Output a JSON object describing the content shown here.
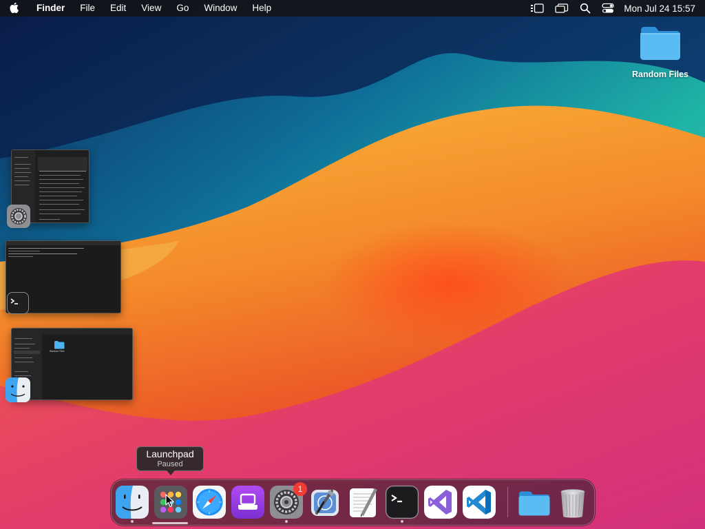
{
  "menubar": {
    "icon": "apple-icon",
    "app_name": "Finder",
    "menus": [
      "File",
      "Edit",
      "View",
      "Go",
      "Window",
      "Help"
    ],
    "status_icons": [
      "stage-manager-icon",
      "screen-mirroring-icon",
      "search-icon",
      "control-center-icon"
    ],
    "clock": "Mon Jul 24  15:57"
  },
  "desktop": {
    "folder": {
      "label": "Random Files",
      "icon": "folder-icon"
    }
  },
  "stage_manager": {
    "windows": [
      {
        "app": "System Settings",
        "icon": "system-settings-icon"
      },
      {
        "app": "Terminal",
        "icon": "terminal-icon"
      },
      {
        "app": "Finder",
        "icon": "finder-icon",
        "item_label": "Random Files"
      }
    ]
  },
  "tooltip": {
    "title": "Launchpad",
    "subtitle": "Paused"
  },
  "dock": {
    "apps": [
      {
        "name": "Finder",
        "icon": "finder-icon",
        "running": true
      },
      {
        "name": "Launchpad",
        "icon": "launchpad-icon",
        "running": false
      },
      {
        "name": "Safari",
        "icon": "safari-icon",
        "running": false
      },
      {
        "name": "Podcast-like App",
        "icon": "purple-app-icon",
        "running": false
      },
      {
        "name": "System Settings",
        "icon": "system-settings-icon",
        "running": true,
        "badge": "1"
      },
      {
        "name": "Xcode Instruments",
        "icon": "xcode-icon",
        "running": false
      },
      {
        "name": "TextEdit",
        "icon": "textedit-icon",
        "running": false
      },
      {
        "name": "Terminal",
        "icon": "terminal-icon",
        "running": true
      },
      {
        "name": "Visual Studio",
        "icon": "visual-studio-icon",
        "running": false
      },
      {
        "name": "Visual Studio Code",
        "icon": "vscode-icon",
        "running": false
      },
      {
        "name": "Downloads Folder",
        "icon": "folder-icon",
        "running": false
      },
      {
        "name": "Trash",
        "icon": "trash-icon",
        "running": false
      }
    ]
  },
  "colors": {
    "menubar_bg": "#141418",
    "folder_blue": "#4fb3f0",
    "badge_red": "#f23c33"
  }
}
